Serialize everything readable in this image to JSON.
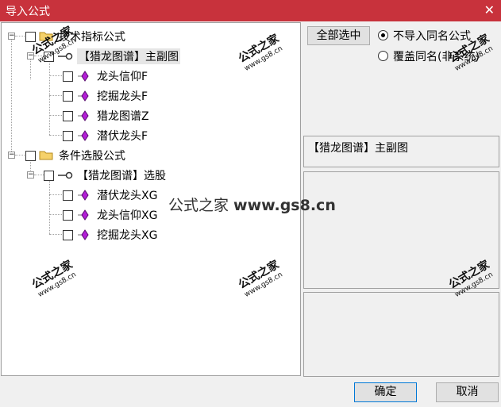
{
  "window": {
    "title": "导入公式",
    "close_glyph": "✕"
  },
  "tree": {
    "groups": [
      {
        "label": "技术指标公式",
        "sub": {
          "label": "【猎龙图谱】主副图",
          "items": [
            "龙头信仰F",
            "挖掘龙头F",
            "猎龙图谱Z",
            "潜伏龙头F"
          ]
        }
      },
      {
        "label": "条件选股公式",
        "sub": {
          "label": "【猎龙图谱】选股",
          "items": [
            "潜伏龙头XG",
            "龙头信仰XG",
            "挖掘龙头XG"
          ]
        }
      }
    ]
  },
  "right": {
    "select_all": "全部选中",
    "radio_skip": "不导入同名公式",
    "radio_overwrite": "覆盖同名(非系统)",
    "selected_info": "【猎龙图谱】主副图"
  },
  "buttons": {
    "ok": "确定",
    "cancel": "取消"
  },
  "watermark": {
    "cn": "公式之家",
    "url": "www.gs8.cn",
    "center_cn": "公式之家 ",
    "center_url": "www.gs8.cn"
  }
}
